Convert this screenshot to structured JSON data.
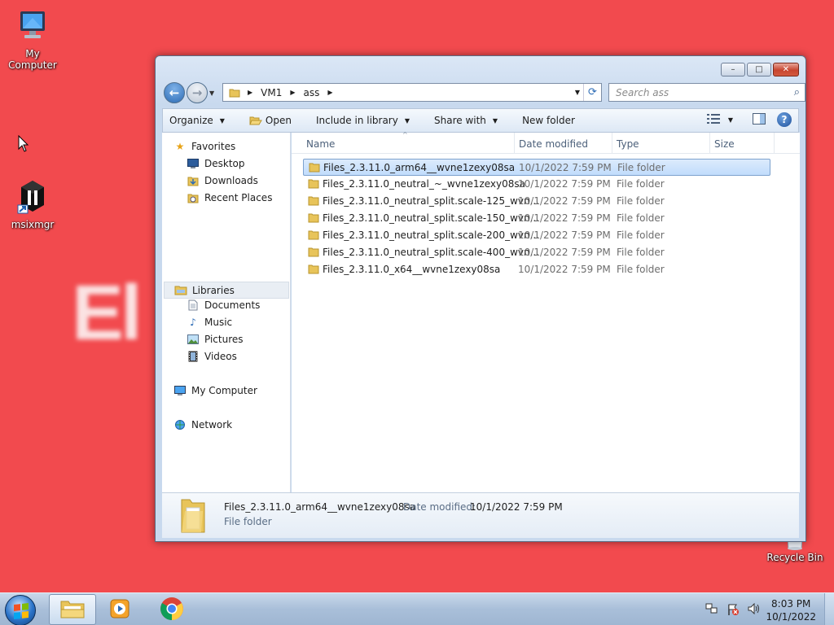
{
  "desktop": {
    "wallpaper_text": "El",
    "icons": [
      {
        "label": "My Computer",
        "icon": "computer-icon"
      },
      {
        "label": "msixmgr",
        "icon": "msixmgr-app-icon"
      },
      {
        "label": "Recycle Bin",
        "icon": "recycle-bin-icon"
      }
    ]
  },
  "window": {
    "caption": {
      "minimize": "–",
      "maximize": "□",
      "close": "✕"
    },
    "address": {
      "segments": [
        "VM1",
        "ass"
      ]
    },
    "search": {
      "placeholder": "Search ass"
    },
    "toolbar": {
      "organize": "Organize",
      "open": "Open",
      "include_in_library": "Include in library",
      "share_with": "Share with",
      "new_folder": "New folder"
    },
    "nav": {
      "favorites": "Favorites",
      "desktop": "Desktop",
      "downloads": "Downloads",
      "recent_places": "Recent Places",
      "libraries": "Libraries",
      "documents": "Documents",
      "music": "Music",
      "pictures": "Pictures",
      "videos": "Videos",
      "my_computer": "My Computer",
      "network": "Network"
    },
    "columns": {
      "name": "Name",
      "date_modified": "Date modified",
      "type": "Type",
      "size": "Size"
    },
    "files": [
      {
        "name": "Files_2.3.11.0_arm64__wvne1zexy08sa",
        "date": "10/1/2022 7:59 PM",
        "type": "File folder"
      },
      {
        "name": "Files_2.3.11.0_neutral_~_wvne1zexy08sa",
        "date": "10/1/2022 7:59 PM",
        "type": "File folder"
      },
      {
        "name": "Files_2.3.11.0_neutral_split.scale-125_wvn...",
        "date": "10/1/2022 7:59 PM",
        "type": "File folder"
      },
      {
        "name": "Files_2.3.11.0_neutral_split.scale-150_wvn...",
        "date": "10/1/2022 7:59 PM",
        "type": "File folder"
      },
      {
        "name": "Files_2.3.11.0_neutral_split.scale-200_wvn...",
        "date": "10/1/2022 7:59 PM",
        "type": "File folder"
      },
      {
        "name": "Files_2.3.11.0_neutral_split.scale-400_wvn...",
        "date": "10/1/2022 7:59 PM",
        "type": "File folder"
      },
      {
        "name": "Files_2.3.11.0_x64__wvne1zexy08sa",
        "date": "10/1/2022 7:59 PM",
        "type": "File folder"
      }
    ],
    "details": {
      "name": "Files_2.3.11.0_arm64__wvne1zexy08sa",
      "date_label": "Date modified:",
      "date_value": "10/1/2022 7:59 PM",
      "type": "File folder"
    }
  },
  "taskbar": {
    "clock_time": "8:03 PM",
    "clock_date": "10/1/2022"
  },
  "colors": {
    "desktop_bg": "#f24a4e",
    "selection": "#c1dcfc",
    "folder": "#e8c45a"
  }
}
